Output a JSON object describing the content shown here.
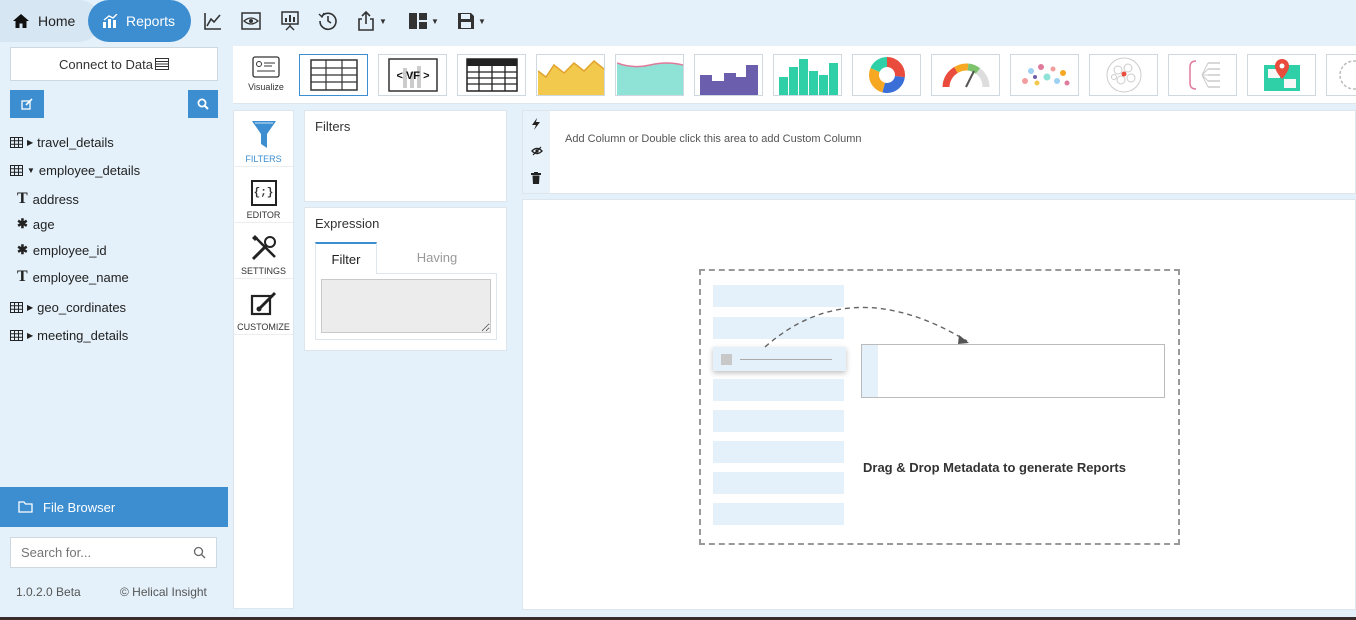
{
  "nav": {
    "home_label": "Home",
    "reports_label": "Reports",
    "tools": [
      "line-chart-icon",
      "preview-icon",
      "presentation-icon",
      "history-icon",
      "export-icon",
      "layout-icon",
      "save-icon"
    ]
  },
  "sidebar": {
    "connect_label": "Connect to Data",
    "tree": {
      "travel_details": "travel_details",
      "employee_details": "employee_details",
      "address": "address",
      "age": "age",
      "employee_id": "employee_id",
      "employee_name": "employee_name",
      "geo_cordinates": "geo_cordinates",
      "meeting_details": "meeting_details"
    },
    "file_browser_label": "File Browser",
    "search_placeholder": "Search for...",
    "version": "1.0.2.0 Beta",
    "copyright": "© Helical Insight"
  },
  "visualize": {
    "label": "Visualize",
    "vf_label": "< VF >",
    "chart_types": [
      "table",
      "vf",
      "pivot-table",
      "area",
      "stream",
      "step-bar",
      "bar",
      "donut",
      "gauge",
      "scatter",
      "bubble-pack",
      "tree",
      "map",
      "more"
    ]
  },
  "tools_panel": {
    "filters": "FILTERS",
    "editor": "EDITOR",
    "settings": "SETTINGS",
    "customize": "CUSTOMIZE",
    "editor_symbol": "{;}"
  },
  "filters_panel": {
    "title": "Filters",
    "expression_title": "Expression",
    "tab_filter": "Filter",
    "tab_having": "Having"
  },
  "columns": {
    "hint": "Add Column or Double click this area to add Custom Column"
  },
  "canvas": {
    "drop_message": "Drag & Drop Metadata to generate Reports"
  },
  "colors": {
    "accent": "#3c8ed0",
    "background": "#e4f1fa",
    "panel": "#ffffff"
  }
}
